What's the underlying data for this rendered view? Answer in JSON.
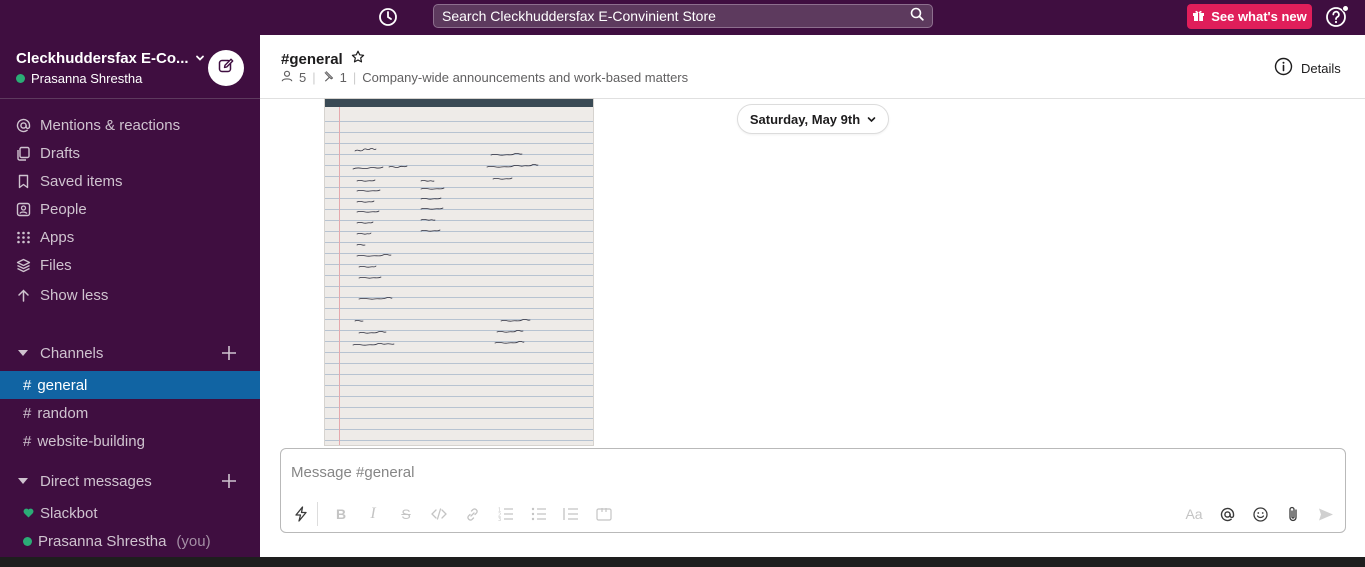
{
  "topbar": {
    "search_placeholder": "Search Cleckhuddersfax E-Convinient Store",
    "whats_new_label": "See what's new",
    "icons": [
      "history-icon",
      "search-icon",
      "gift-icon",
      "help-icon"
    ]
  },
  "workspace": {
    "name": "Cleckhuddersfax E-Co...",
    "user": "Prasanna Shrestha",
    "status_color": "#2bac76"
  },
  "sidebar": {
    "nav": [
      {
        "label": "Mentions & reactions",
        "icon": "at-icon"
      },
      {
        "label": "Drafts",
        "icon": "drafts-icon"
      },
      {
        "label": "Saved items",
        "icon": "bookmark-icon"
      },
      {
        "label": "People",
        "icon": "people-icon"
      },
      {
        "label": "Apps",
        "icon": "apps-grid-icon"
      },
      {
        "label": "Files",
        "icon": "files-layers-icon"
      },
      {
        "label": "Show less",
        "icon": "arrow-up-icon"
      }
    ],
    "channels_label": "Channels",
    "channels": [
      {
        "name": "general",
        "active": true
      },
      {
        "name": "random",
        "active": false
      },
      {
        "name": "website-building",
        "active": false
      }
    ],
    "dms_label": "Direct messages",
    "dms": [
      {
        "name": "Slackbot",
        "you": ""
      },
      {
        "name": "Prasanna Shrestha",
        "you": "(you)"
      }
    ]
  },
  "channel": {
    "title": "#general",
    "members": "5",
    "pins": "1",
    "description": "Company-wide announcements and work-based matters",
    "details_label": "Details"
  },
  "messages": {
    "date_divider": "Saturday, May 9th"
  },
  "composer": {
    "placeholder": "Message #general",
    "tools": [
      "shortcuts-lightning-icon",
      "bold-icon",
      "italic-icon",
      "strikethrough-icon",
      "code-icon",
      "link-icon",
      "ordered-list-icon",
      "bulleted-list-icon",
      "blockquote-icon",
      "code-block-icon",
      "text-format-icon",
      "mention-at-icon",
      "emoji-icon",
      "attachment-icon",
      "send-icon"
    ]
  },
  "colors": {
    "sidebar_bg": "#3f0e40",
    "active_channel": "#1164a3",
    "whats_new_bg": "#e01e5a"
  }
}
